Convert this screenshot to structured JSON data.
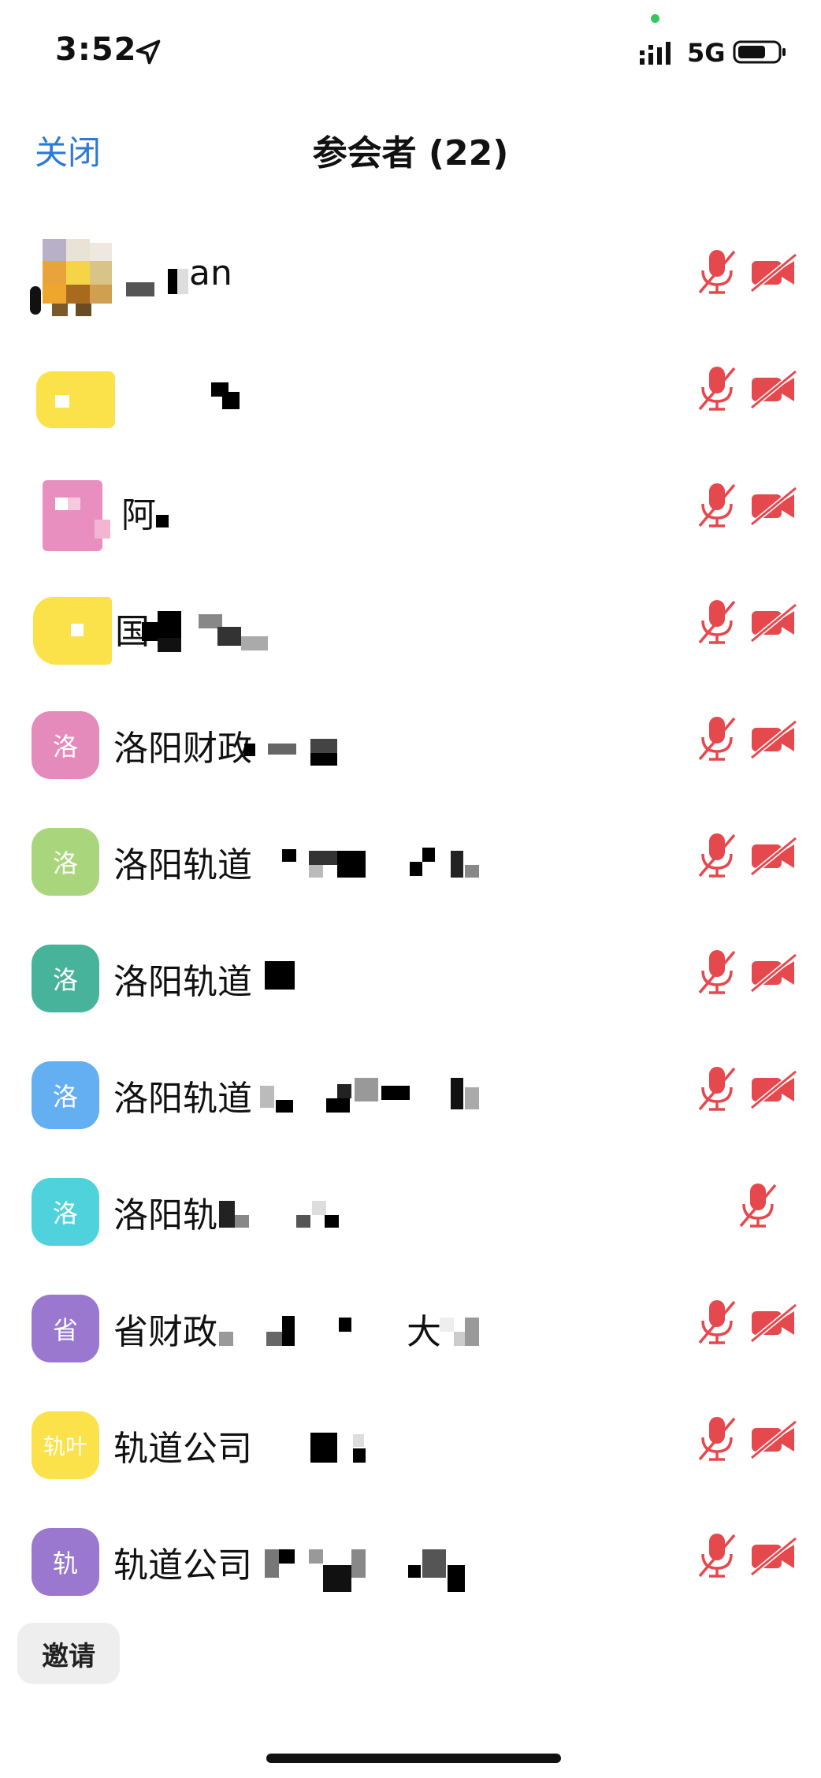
{
  "status_bar": {
    "time": "3:52",
    "network": "5G"
  },
  "header": {
    "close_label": "关闭",
    "title": "参会者 (22)"
  },
  "colors": {
    "accent": "#2d79d6",
    "muted_icon": "#e5484d"
  },
  "participants": [
    {
      "name": "an",
      "avatar_text": "",
      "avatar_color": "",
      "mic_muted": true,
      "video_off": true
    },
    {
      "name": "",
      "avatar_text": "",
      "avatar_color": "#fbe14a",
      "mic_muted": true,
      "video_off": true
    },
    {
      "name": "阿",
      "avatar_text": "",
      "avatar_color": "#e88fbf",
      "mic_muted": true,
      "video_off": true
    },
    {
      "name": "国",
      "avatar_text": "",
      "avatar_color": "#fbe14a",
      "mic_muted": true,
      "video_off": true
    },
    {
      "name": "洛阳财政",
      "avatar_text": "洛",
      "avatar_color": "#e48bbb",
      "mic_muted": true,
      "video_off": true
    },
    {
      "name": "洛阳轨道",
      "avatar_text": "洛",
      "avatar_color": "#a9d67c",
      "mic_muted": true,
      "video_off": true
    },
    {
      "name": "洛阳轨道",
      "avatar_text": "洛",
      "avatar_color": "#47b39b",
      "mic_muted": true,
      "video_off": true
    },
    {
      "name": "洛阳轨道",
      "avatar_text": "洛",
      "avatar_color": "#64aef2",
      "mic_muted": true,
      "video_off": true
    },
    {
      "name": "洛阳轨",
      "avatar_text": "洛",
      "avatar_color": "#4fd2db",
      "mic_muted": true,
      "video_off": false
    },
    {
      "name": "省财政",
      "avatar_text": "省",
      "avatar_color": "#9a78cf",
      "mic_muted": true,
      "video_off": true
    },
    {
      "name": "轨道公司",
      "avatar_text": "轨叶",
      "avatar_color": "#fbe14a",
      "mic_muted": true,
      "video_off": true
    },
    {
      "name": "轨道公司",
      "avatar_text": "轨",
      "avatar_color": "#9a78cf",
      "mic_muted": true,
      "video_off": true
    }
  ],
  "invite": {
    "label": "邀请"
  }
}
